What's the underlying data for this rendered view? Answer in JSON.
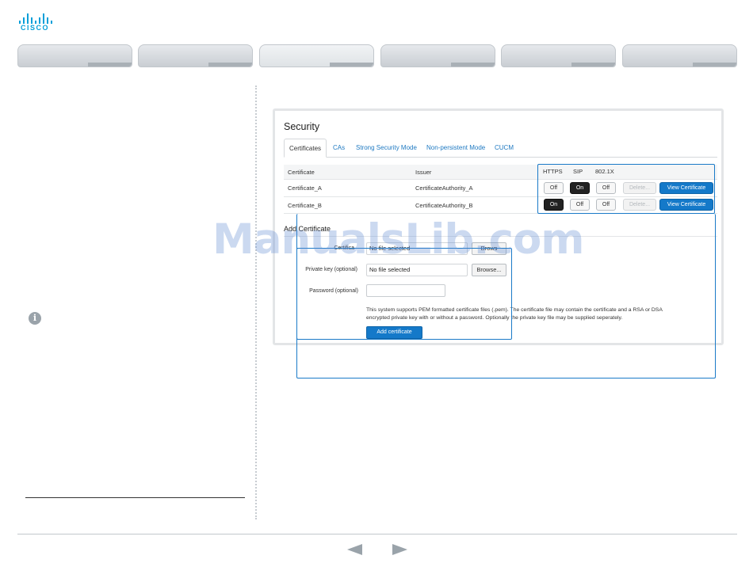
{
  "brand": {
    "logo_text": "CISCO",
    "color": "#049fd9"
  },
  "nav_tabs": [
    "",
    "",
    "",
    "",
    "",
    ""
  ],
  "security": {
    "title": "Security",
    "tabs": [
      "Certificates",
      "CAs",
      "Strong Security Mode",
      "Non-persistent Mode",
      "CUCM"
    ],
    "active_tab": "Certificates",
    "table": {
      "headers": {
        "certificate": "Certificate",
        "issuer": "Issuer",
        "https": "HTTPS",
        "sip": "SIP",
        "dot1x": "802.1X"
      },
      "rows": [
        {
          "certificate": "Certificate_A",
          "issuer": "CertificateAuthority_A",
          "https": "Off",
          "sip": "On",
          "dot1x": "Off",
          "delete": "Delete...",
          "view": "View Certificate"
        },
        {
          "certificate": "Certificate_B",
          "issuer": "CertificateAuthority_B",
          "https": "On",
          "sip": "Off",
          "dot1x": "Off",
          "delete": "Delete...",
          "view": "View Certificate"
        }
      ]
    },
    "add": {
      "title": "Add Certificate",
      "certificate_label": "Certifica",
      "certificate_value": "No file selected",
      "certificate_browse": "Brows",
      "private_key_label": "Private key (optional)",
      "private_key_value": "No file selected",
      "private_key_browse": "Browse...",
      "password_label": "Password (optional)",
      "help_line1": "This system supports PEM formatted certificate files (.pem). The certificate file may contain the certificate and a RSA or DSA",
      "help_line2": "encrypted private key with or without a password. Optionally the private key file may be supplied seperately.",
      "button": "Add certificate"
    }
  },
  "watermark": "ManualsLib.com",
  "left": {
    "info_glyph": "i"
  },
  "colors": {
    "accent": "#1479c9",
    "callout": "#1a7ac8",
    "on_button": "#222222"
  }
}
